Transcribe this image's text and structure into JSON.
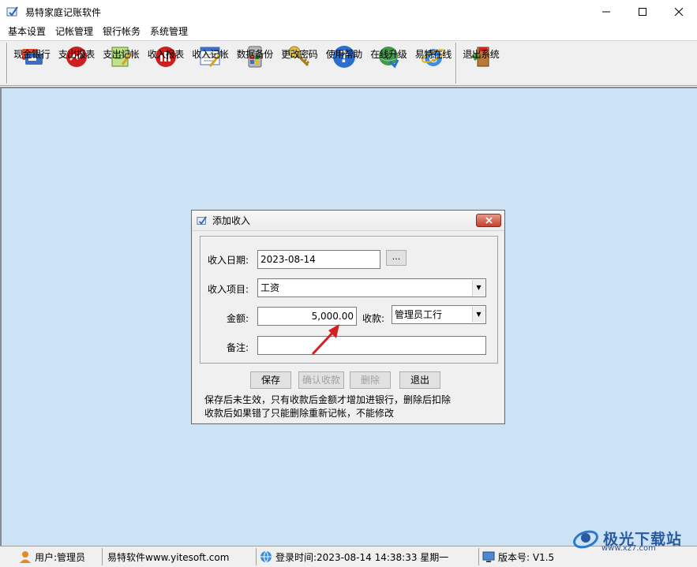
{
  "window": {
    "title": "易特家庭记账软件"
  },
  "menu": [
    "基本设置",
    "记帐管理",
    "银行帐务",
    "系统管理"
  ],
  "toolbar": [
    {
      "label": "现金银行",
      "icon": "cash-bank-icon"
    },
    {
      "label": "支出报表",
      "icon": "expense-report-icon"
    },
    {
      "label": "支出记帐",
      "icon": "expense-entry-icon"
    },
    {
      "label": "收入报表",
      "icon": "income-report-icon"
    },
    {
      "label": "收入记帐",
      "icon": "income-entry-icon"
    },
    {
      "label": "数据备份",
      "icon": "backup-icon"
    },
    {
      "label": "更改密码",
      "icon": "key-icon"
    },
    {
      "label": "使用帮助",
      "icon": "help-icon"
    },
    {
      "label": "在线升级",
      "icon": "globe-icon"
    },
    {
      "label": "易特在线",
      "icon": "ie-icon"
    },
    {
      "label": "退出系统",
      "icon": "exit-icon"
    }
  ],
  "dialog": {
    "title": "添加收入",
    "date_label": "收入日期:",
    "date_value": "2023-08-14",
    "dots_label": "...",
    "item_label": "收入项目:",
    "item_value": "工资",
    "amount_label": "金额:",
    "amount_value": "5,000.00",
    "account_label": "收款:",
    "account_value": "管理员工行",
    "remark_label": "备注:",
    "remark_value": "",
    "buttons": {
      "save": "保存",
      "confirm": "确认收款",
      "delete": "删除",
      "exit": "退出"
    },
    "note_line1": "保存后未生效，只有收款后金额才增加进银行，删除后扣除",
    "note_line2": "收款后如果错了只能删除重新记帐，不能修改"
  },
  "status": {
    "user": "用户:管理员",
    "company": "易特软件www.yitesoft.com",
    "login": "登录时间:2023-08-14 14:38:33 星期一",
    "version": "版本号: V1.5"
  },
  "watermark": {
    "text": "极光下载站",
    "url": "www.xz7.com"
  },
  "colors": {
    "workspace": "#cce3f6",
    "accent_close": "#c2412c",
    "arrow": "#d42020"
  }
}
